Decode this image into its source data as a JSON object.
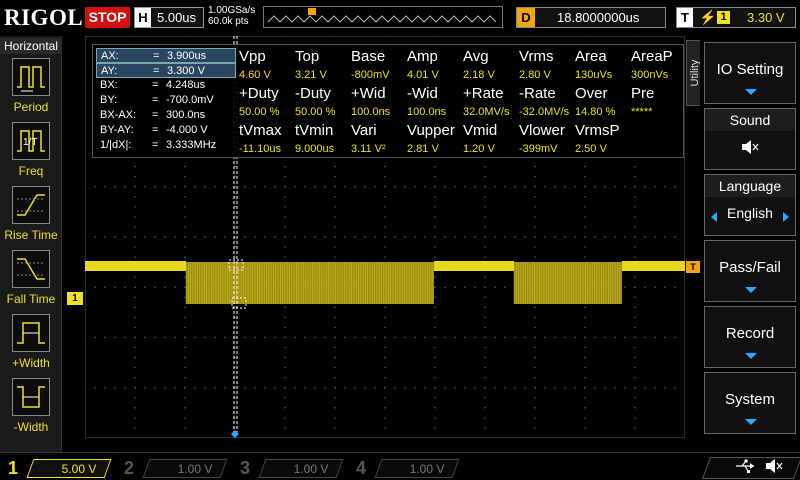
{
  "brand": {
    "logo": "RIGOL"
  },
  "top": {
    "run_state": "STOP",
    "h_label": "H",
    "h_timebase": "5.00us",
    "sample_rate": "1.00GSa/s",
    "mem_depth": "60.0k pts",
    "delay_label": "D",
    "delay_value": "18.8000000us",
    "trig_label": "T",
    "trig_edge": "⚡",
    "trig_channel": "1",
    "trig_level": "3.30 V"
  },
  "left": {
    "title": "Horizontal",
    "tools": [
      {
        "label": "Period"
      },
      {
        "label": "Freq"
      },
      {
        "label": "Rise Time"
      },
      {
        "label": "Fall Time"
      },
      {
        "label": "+Width"
      },
      {
        "label": "-Width"
      }
    ]
  },
  "right": {
    "tab": "Utility",
    "io_setting": "IO Setting",
    "sound": "Sound",
    "language_title": "Language",
    "language_value": "English",
    "pass_fail": "Pass/Fail",
    "record": "Record",
    "system": "System"
  },
  "cursors": [
    {
      "k": "AX:",
      "eq": "=",
      "v": "3.900us",
      "hl": true
    },
    {
      "k": "AY:",
      "eq": "=",
      "v": "3.300 V",
      "hl": true
    },
    {
      "k": "BX:",
      "eq": "=",
      "v": "4.248us",
      "hl": false
    },
    {
      "k": "BY:",
      "eq": "=",
      "v": "-700.0mV",
      "hl": false
    },
    {
      "k": "BX-AX:",
      "eq": "=",
      "v": "300.0ns",
      "hl": false
    },
    {
      "k": "BY-AY:",
      "eq": "=",
      "v": "-4.000 V",
      "hl": false
    },
    {
      "k": "1/|dX|:",
      "eq": "=",
      "v": "3.333MHz",
      "hl": false
    }
  ],
  "measurements": {
    "row1_headers": [
      "Vpp",
      "Top",
      "Base",
      "Amp",
      "Avg",
      "Vrms",
      "Area",
      "AreaP"
    ],
    "row1_values": [
      "4.60 V",
      "3.21 V",
      "-800mV",
      "4.01 V",
      "2.18 V",
      "2.80 V",
      "130uVs",
      "300nVs"
    ],
    "row2_headers": [
      "+Duty",
      "-Duty",
      "+Wid",
      "-Wid",
      "+Rate",
      "-Rate",
      "Over",
      "Pre"
    ],
    "row2_values": [
      "50.00 %",
      "50.00 %",
      "100.0ns",
      "100.0ns",
      "32.0MV/s",
      "-32.0MV/s",
      "14.80 %",
      "*****"
    ],
    "row3_headers": [
      "tVmax",
      "tVmin",
      "Vari",
      "Vupper",
      "Vmid",
      "Vlower",
      "VrmsP"
    ],
    "row3_values": [
      "-11.10us",
      "9.000us",
      "3.11 V²",
      "2.81 V",
      "1.20 V",
      "-399mV",
      "2.50 V"
    ]
  },
  "channels": [
    {
      "num": "1",
      "scale": "5.00 V",
      "color": "#f0e020",
      "active": true
    },
    {
      "num": "2",
      "scale": "1.00 V",
      "color": "#19b8c8",
      "active": false
    },
    {
      "num": "3",
      "scale": "1.00 V",
      "color": "#c030c0",
      "active": false
    },
    {
      "num": "4",
      "scale": "1.00 V",
      "color": "#2060d8",
      "active": false
    }
  ],
  "markers": {
    "ch1": "1",
    "trigger": "T"
  },
  "colors": {
    "ch1": "#f0e020",
    "accent": "#2aa8ff",
    "stop": "#d21010",
    "delay": "#f5a30a"
  }
}
